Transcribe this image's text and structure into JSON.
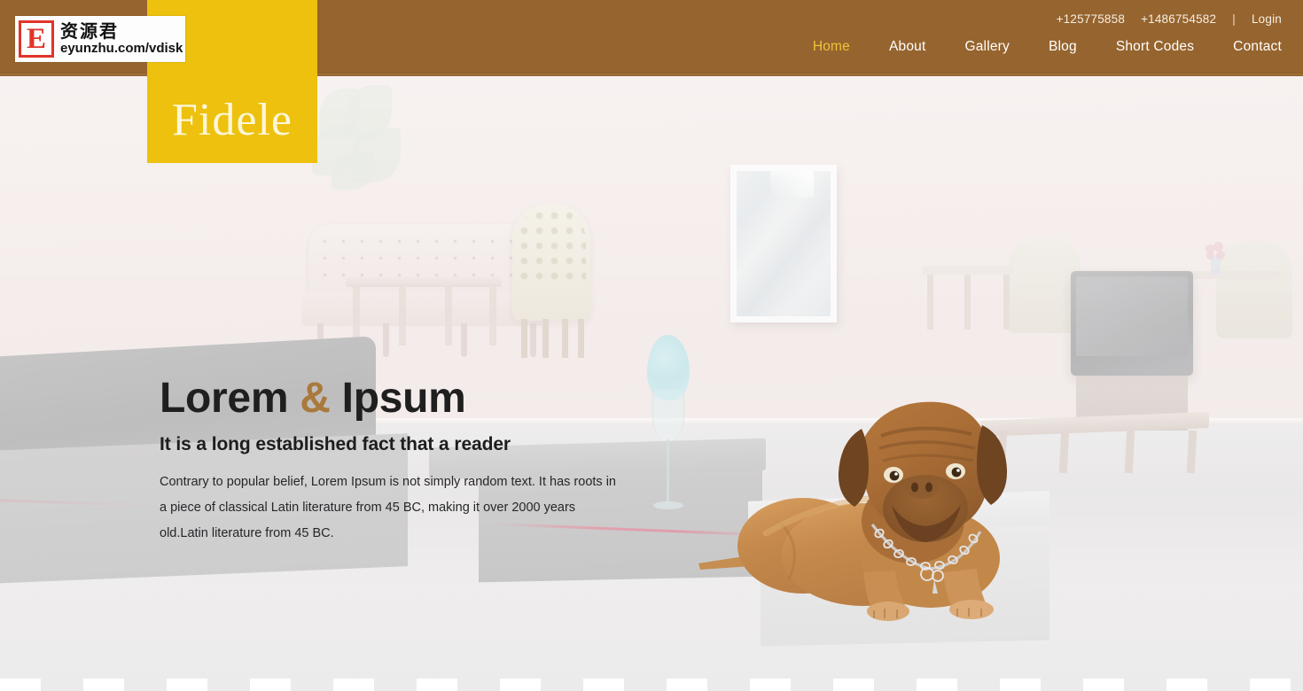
{
  "site": {
    "brand": "Fidele",
    "brand_panel_color": "#edc10d",
    "header_color": "#96642e",
    "accent_color": "#f0c23a"
  },
  "watermark": {
    "letter": "E",
    "chinese": "资源君",
    "url": "eyunzhu.com/vdisk"
  },
  "topbar": {
    "phone1": "+125775858",
    "phone2": "+1486754582",
    "separator": "|",
    "login": "Login"
  },
  "nav": {
    "items": [
      {
        "label": "Home",
        "active": true
      },
      {
        "label": "About",
        "active": false
      },
      {
        "label": "Gallery",
        "active": false
      },
      {
        "label": "Blog",
        "active": false
      },
      {
        "label": "Short Codes",
        "active": false
      },
      {
        "label": "Contact",
        "active": false
      }
    ]
  },
  "hero": {
    "title_part1": "Lorem",
    "title_amp": "&",
    "title_part2": "Ipsum",
    "subtitle": "It is a long established fact that a reader",
    "paragraph": "Contrary to popular belief, Lorem Ipsum is not simply random text. It has roots in a piece of classical Latin literature from 45 BC, making it over 2000 years old.Latin literature from 45 BC.",
    "background_scene": "bright-interior-living-room",
    "foreground_subject": "dogue-de-bordeaux-dog-with-chain-collar"
  }
}
